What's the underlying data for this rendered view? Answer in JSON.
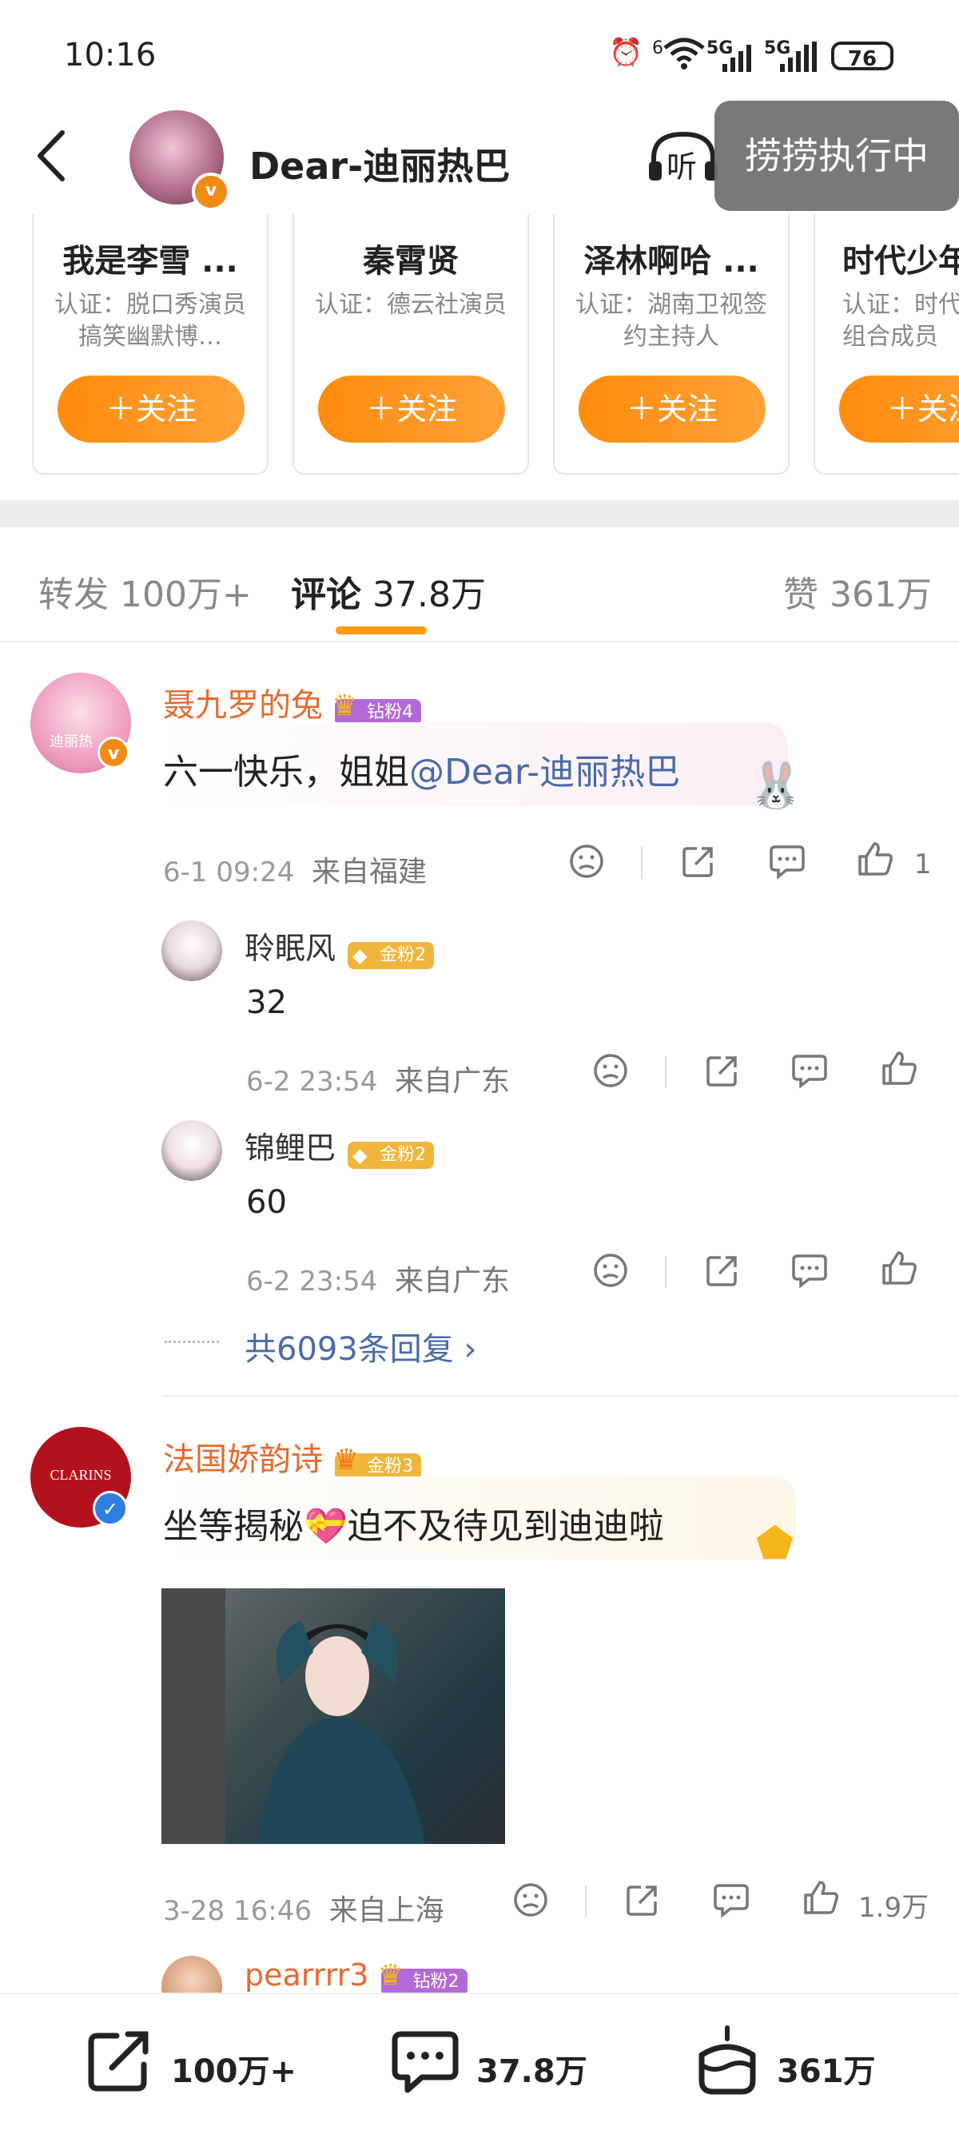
{
  "status": {
    "time": "10:16",
    "net1": "6",
    "net2": "5G",
    "net3": "5G",
    "battery": "76"
  },
  "header": {
    "title": "Dear-迪丽热巴",
    "listen_label": "听",
    "toast": "捞捞执行中",
    "verified": "v"
  },
  "rec_cards": [
    {
      "name": "我是李雪 ...",
      "desc": "认证：脱口秀演员 搞笑幽默博…",
      "btn": "＋关注"
    },
    {
      "name": "秦霄贤",
      "desc": "认证：德云社演员",
      "btn": "＋关注"
    },
    {
      "name": "泽林啊哈 ...",
      "desc": "认证：湖南卫视签约主持人",
      "btn": "＋关注"
    },
    {
      "name": "时代少年",
      "desc": "认证：时代少年团组合成员",
      "btn": "＋关注"
    }
  ],
  "tabs": {
    "repost": {
      "label": "转发",
      "count": "100万+"
    },
    "comment": {
      "label": "评论",
      "count": "37.8万"
    },
    "like": {
      "label": "赞",
      "count": "361万"
    }
  },
  "comments": [
    {
      "user": "聂九罗的兔",
      "badge": "钻粉4",
      "text_plain": "六一快乐，姐姐",
      "mention": "@Dear-迪丽热巴",
      "time": "6-1 09:24",
      "location": "来自福建",
      "likes": "1",
      "replies": [
        {
          "user": "聆眠风",
          "badge": "金粉2",
          "text": "32",
          "time": "6-2 23:54",
          "location": "来自广东"
        },
        {
          "user": "锦鲤巴",
          "badge": "金粉2",
          "text": "60",
          "time": "6-2 23:54",
          "location": "来自广东"
        }
      ],
      "more_replies": "共6093条回复",
      "avatar_text": "迪丽热"
    },
    {
      "user": "法国娇韵诗",
      "badge": "金粉3",
      "avatar_text": "CLARINS",
      "text": "坐等揭秘💝迫不及待见到迪迪啦",
      "time": "3-28 16:46",
      "location": "来自上海",
      "likes": "1.9万"
    },
    {
      "user": "pearrrr3",
      "badge": "钻粉2"
    }
  ],
  "bottom": {
    "repost": "100万+",
    "comment": "37.8万",
    "like": "361万"
  },
  "colors": {
    "accent": "#ff8c0c",
    "username": "#e8692d",
    "link": "#4a6aa8"
  }
}
